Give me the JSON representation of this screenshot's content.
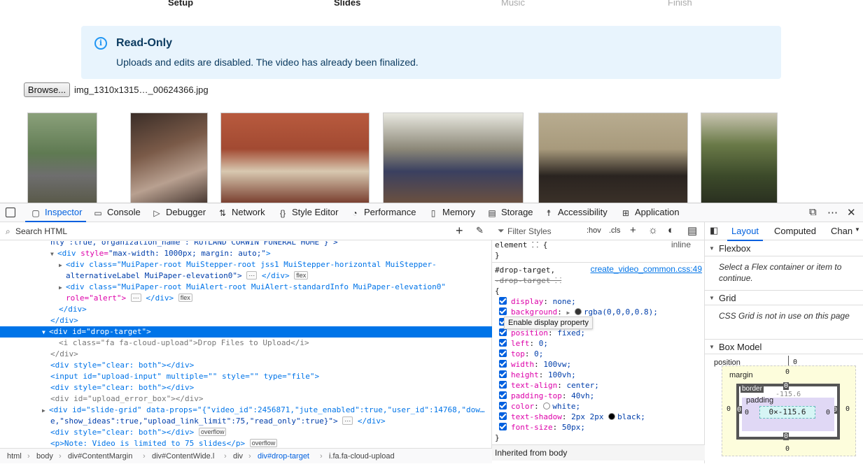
{
  "stepper": {
    "steps": [
      "Setup",
      "Slides",
      "Music",
      "Finish"
    ]
  },
  "alert": {
    "title": "Read-Only",
    "message": "Uploads and edits are disabled.  The video has already been finalized.",
    "icon": "info-icon"
  },
  "file_input": {
    "button_label": "Browse...",
    "file_name": "img_1310x1315…_00624366.jpg"
  },
  "photos": [
    {
      "name": "photo-1",
      "color": "#6f7a5c"
    },
    {
      "name": "photo-2",
      "color": "#5b4a3e"
    },
    {
      "name": "photo-3",
      "color": "#a0523a"
    },
    {
      "name": "photo-4",
      "color": "#7d7a6a"
    },
    {
      "name": "photo-5",
      "color": "#9a8e74"
    },
    {
      "name": "photo-6",
      "color": "#55603e"
    }
  ],
  "devtools": {
    "tabs": [
      "Inspector",
      "Console",
      "Debugger",
      "Network",
      "Style Editor",
      "Performance",
      "Memory",
      "Storage",
      "Accessibility",
      "Application"
    ],
    "search_placeholder": "Search HTML",
    "markup": {
      "l0": "nly\":true,\"organization_name\":\"RUTLAND CORWIN FUNERAL HOME\"}\">",
      "l1_tag": "<div",
      "l1_attr": " style=",
      "l1_val": "\"max-width: 1000px; margin: auto;\"",
      "l1_end": ">",
      "l2_text": "<div class=\"MuiPaper-root MuiStepper-root jss1 MuiStepper-horizontal MuiStepper-",
      "l3_text": "alternativeLabel MuiPaper-elevation0\">",
      "l3_end": "</div>",
      "badge_flex": "flex",
      "badge_overflow": "overflow",
      "ellipsis": "⋯",
      "l4_text": "<div class=\"MuiPaper-root MuiAlert-root MuiAlert-standardInfo MuiPaper-elevation0\"",
      "l5_text": "role=\"alert\">",
      "l5_end": "</div>",
      "l6": "</div>",
      "l7": "</div>",
      "l8": "<div id=\"drop-target\">",
      "l9": "<i class=\"fa fa-cloud-upload\">Drop Files to Upload</i>",
      "l10": "</div>",
      "l11": "<div style=\"clear: both\"></div>",
      "l12": "<input id=\"upload-input\" multiple=\"\" style=\"\" type=\"file\">",
      "l13": "<div style=\"clear: both\"></div>",
      "l14": "<div id=\"upload_error_box\"></div>",
      "l15": "<div id=\"slide-grid\" data-props=\"{\"video_id\":2456871,\"jute_enabled\":true,\"user_id\":14768,\"dow…",
      "l16": "e,\"show_ideas\":true,\"upload_link_limit\":75,\"read_only\":true}\">",
      "l16_end": "</div>",
      "l17": "<div style=\"clear: both\"></div>",
      "l18": "<p>Note: Video is limited to 75 slides</p>"
    },
    "breadcrumbs": [
      "html",
      "body",
      "div#ContentMargin",
      "div#ContentWide.l",
      "div",
      "div#drop-target",
      "i.fa.fa-cloud-upload"
    ],
    "styles": {
      "filter_placeholder": "Filter Styles",
      "hov": ":hov",
      "cls": ".cls",
      "element_rule": "element ⸬ {",
      "element_close": "}",
      "inline": "inline",
      "selector1": "#drop-target,",
      "selector2": "-drop-target ⸬",
      "open_brace": "{",
      "close_brace": "}",
      "source": "create_video_common.css:49",
      "decls": [
        {
          "prop": "display",
          "val": "none;"
        },
        {
          "prop": "background",
          "val": "rgba(0,0,0,0.8);"
        },
        {
          "prop": "position",
          "val": "fixed;"
        },
        {
          "prop": "left",
          "val": "0;"
        },
        {
          "prop": "top",
          "val": "0;"
        },
        {
          "prop": "width",
          "val": "100vw;"
        },
        {
          "prop": "height",
          "val": "100vh;"
        },
        {
          "prop": "text-align",
          "val": "center;"
        },
        {
          "prop": "padding-top",
          "val": "40vh;"
        },
        {
          "prop": "color",
          "val": "white;"
        },
        {
          "prop": "text-shadow",
          "val": "2px 2px",
          "val2": "black;"
        },
        {
          "prop": "font-size",
          "val": "50px;"
        }
      ],
      "tooltip": "Enable display property",
      "inherited": "Inherited from body"
    },
    "layout": {
      "tabs": [
        "Layout",
        "Computed",
        "Chan"
      ],
      "flexbox_title": "Flexbox",
      "flexbox_note": "Select a Flex container or item to continue.",
      "grid_title": "Grid",
      "grid_note": "CSS Grid is not in use on this page",
      "boxmodel_title": "Box Model",
      "position_label": "position",
      "position_val": "0",
      "margin_label": "margin",
      "border_label": "border",
      "padding_label": "padding",
      "content_size": "0×-115.6",
      "padding_top": "-115.6",
      "zero": "0"
    }
  }
}
